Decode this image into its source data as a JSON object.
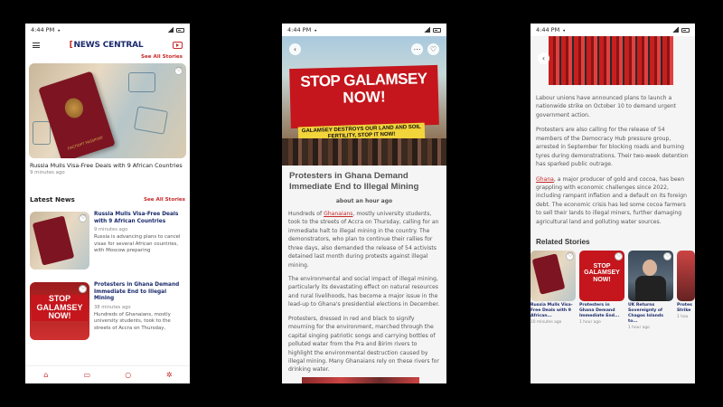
{
  "status_time": "4:44 PM",
  "brand": {
    "logo_text": "NEWS CENTRAL",
    "accent": "#c62828",
    "navy": "#1a2a6c"
  },
  "home": {
    "see_all_top": "See All Stories",
    "hero": {
      "title": "Russia Mulls Visa-Free Deals with 9 African Countries",
      "time": "9 minutes ago"
    },
    "latest_title": "Latest News",
    "see_all_latest": "See All Stories",
    "cards": [
      {
        "title": "Russia Mulls Visa-Free Deals with 9 African Countries",
        "time": "9 minutes ago",
        "text": "Russia is advancing plans to cancel visas for several African countries, with Moscow preparing"
      },
      {
        "title": "Protesters in Ghana Demand Immediate End to Illegal Mining",
        "time": "38 minutes ago",
        "text": "Hundreds of Ghanaians, mostly university students, took to the streets of Accra on Thursday,"
      }
    ],
    "nav": [
      "home-icon",
      "bookmark-icon",
      "search-icon",
      "settings-icon"
    ]
  },
  "article": {
    "banner_line1": "STOP GALAMSEY",
    "banner_line2": "NOW!",
    "banner_sub": "GALAMSEY DESTROYS OUR LAND AND SOIL FERTILITY, STOP IT NOW!",
    "title": "Protesters in Ghana Demand Immediate End to Illegal Mining",
    "time": "about an hour ago",
    "p1_a": "Hundreds of ",
    "p1_link": "Ghanaians",
    "p1_b": ", mostly university students, took to the streets of Accra on Thursday, calling for an immediate halt to illegal mining in the country. The demonstrators, who plan to continue their rallies for three days, also demanded the release of 54 activists detained last month during protests against illegal mining.",
    "p2": "The environmental and social impact of illegal mining, particularly its devastating effect on natural resources and rural livelihoods, has become a major issue in the lead-up to Ghana's presidential elections in December.",
    "p3": "Protesters, dressed in red and black to signify mourning for the environment, marched through the capital singing patriotic songs and carrying bottles of polluted water from the Pra and Birim rivers to highlight the environmental destruction caused by illegal mining. Many Ghanaians rely on these rivers for drinking water."
  },
  "article_cont": {
    "p1": "Labour unions have announced plans to launch a nationwide strike on October 10 to demand urgent government action.",
    "p2": "Protesters are also calling for the release of 54 members of the Democracy Hub pressure group, arrested in September for blocking roads and burning tyres during demonstrations. Their two-week detention has sparked public outrage.",
    "p3_link": "Ghana",
    "p3_b": ", a major producer of gold and cocoa, has been grappling with economic challenges since 2022, including rampant inflation and a default on its foreign debt. The economic crisis has led some cocoa farmers to sell their lands to illegal miners, further damaging agricultural land and polluting water sources.",
    "related_title": "Related Stories",
    "related": [
      {
        "title": "Russia Mulls Visa-Free Deals with 9 African...",
        "time": "10 minutes ago"
      },
      {
        "title": "Protesters in Ghana Demand Immediate End...",
        "time": "1 hour ago"
      },
      {
        "title": "UK Returns Sovereignty of Chagos Islands to...",
        "time": "1 hour ago"
      },
      {
        "title": "Protes Strike",
        "time": "1 hou"
      }
    ]
  }
}
